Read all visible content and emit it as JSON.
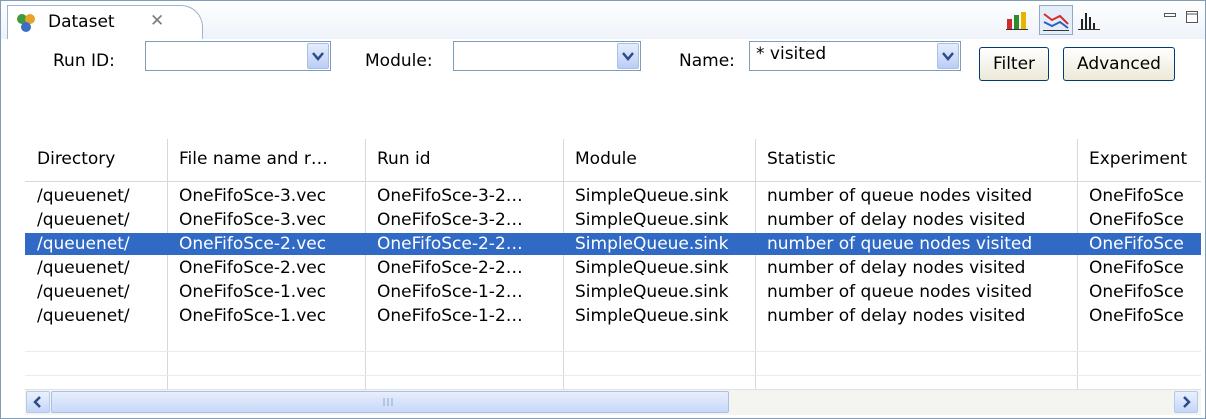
{
  "tab": {
    "title": "Dataset",
    "close_glyph": "✕",
    "icon": "dataset-icon"
  },
  "view_toolbar": {
    "icons": [
      "bar-chart-icon",
      "line-chart-icon",
      "histogram-icon",
      "minimize-icon",
      "maximize-icon"
    ],
    "selected": "line-chart-icon"
  },
  "filters": {
    "run_id": {
      "label": "Run ID:",
      "value": ""
    },
    "module": {
      "label": "Module:",
      "value": ""
    },
    "name": {
      "label": "Name:",
      "value": "* visited"
    },
    "filter_button": "Filter",
    "advanced_button": "Advanced"
  },
  "table": {
    "columns": [
      "Directory",
      "File name and r…",
      "Run id",
      "Module",
      "Statistic",
      "Experiment"
    ],
    "rows": [
      [
        "/queuenet/",
        "OneFifoSce-3.vec",
        "OneFifoSce-3-2…",
        "SimpleQueue.sink",
        "number of queue nodes visited",
        "OneFifoSce"
      ],
      [
        "/queuenet/",
        "OneFifoSce-3.vec",
        "OneFifoSce-3-2…",
        "SimpleQueue.sink",
        "number of delay nodes visited",
        "OneFifoSce"
      ],
      [
        "/queuenet/",
        "OneFifoSce-2.vec",
        "OneFifoSce-2-2…",
        "SimpleQueue.sink",
        "number of queue nodes visited",
        "OneFifoSce"
      ],
      [
        "/queuenet/",
        "OneFifoSce-2.vec",
        "OneFifoSce-2-2…",
        "SimpleQueue.sink",
        "number of delay nodes visited",
        "OneFifoSce"
      ],
      [
        "/queuenet/",
        "OneFifoSce-1.vec",
        "OneFifoSce-1-2…",
        "SimpleQueue.sink",
        "number of queue nodes visited",
        "OneFifoSce"
      ],
      [
        "/queuenet/",
        "OneFifoSce-1.vec",
        "OneFifoSce-1-2…",
        "SimpleQueue.sink",
        "number of delay nodes visited",
        "OneFifoSce"
      ]
    ],
    "selected_row": 2
  },
  "scrollbar": {
    "left_arrow": "<",
    "right_arrow": ">",
    "grip": "III"
  }
}
